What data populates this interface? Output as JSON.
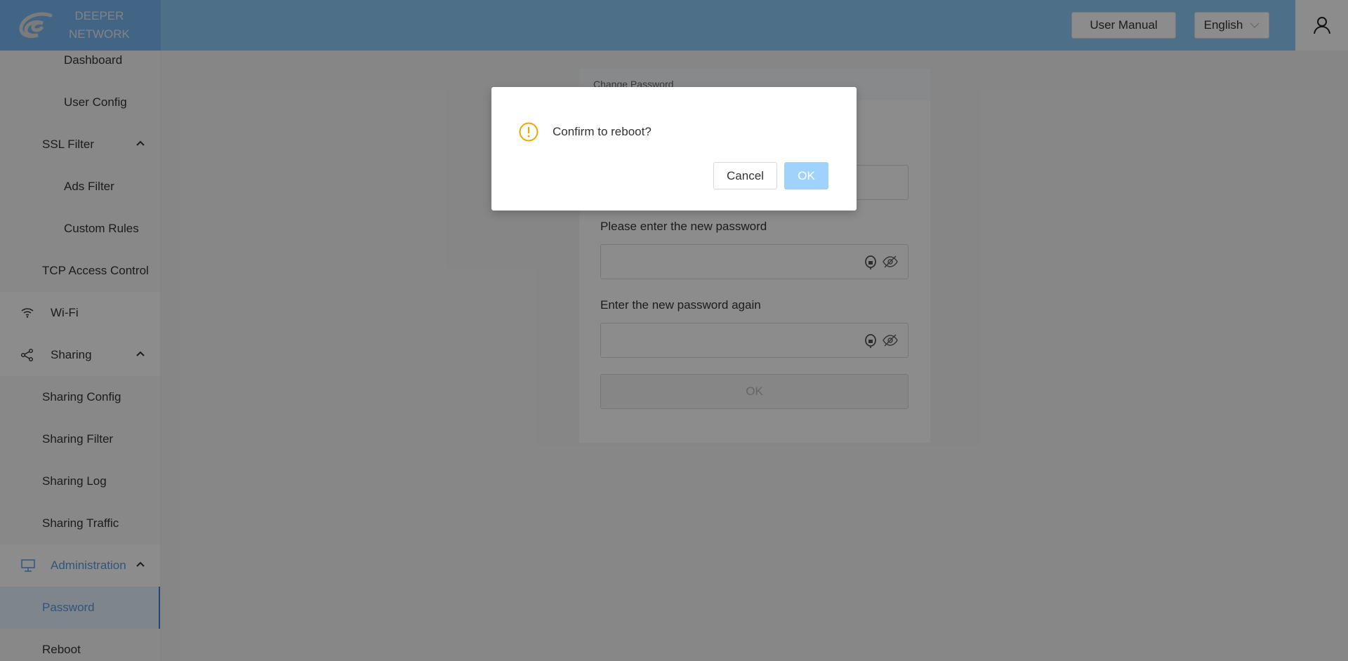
{
  "header": {
    "logo_line1": "DEEPER",
    "logo_line2": "NETWORK",
    "user_manual": "User Manual",
    "language": "English"
  },
  "sidebar": {
    "items": [
      {
        "label": "Dashboard",
        "level": 2
      },
      {
        "label": "User Config",
        "level": 2
      },
      {
        "label": "SSL Filter",
        "level": 1,
        "expanded": true
      },
      {
        "label": "Ads Filter",
        "level": 2
      },
      {
        "label": "Custom Rules",
        "level": 2
      },
      {
        "label": "TCP Access Control",
        "level": 1
      },
      {
        "label": "Wi-Fi",
        "icon": "wifi-icon"
      },
      {
        "label": "Sharing",
        "icon": "share-icon",
        "expanded": true
      },
      {
        "label": "Sharing Config"
      },
      {
        "label": "Sharing Filter"
      },
      {
        "label": "Sharing Log"
      },
      {
        "label": "Sharing Traffic"
      },
      {
        "label": "Administration",
        "icon": "monitor-icon",
        "expanded": true
      },
      {
        "label": "Password",
        "active": true
      },
      {
        "label": "Reboot"
      }
    ]
  },
  "card": {
    "title": "Change Password",
    "new_label": "Please enter the new password",
    "again_label": "Enter the new password again",
    "ok": "OK"
  },
  "dialog": {
    "message": "Confirm to reboot?",
    "cancel": "Cancel",
    "ok": "OK"
  },
  "colors": {
    "accent": "#1890ff",
    "warning": "#f0a500",
    "ok_disabled": "#9fd3fd"
  }
}
